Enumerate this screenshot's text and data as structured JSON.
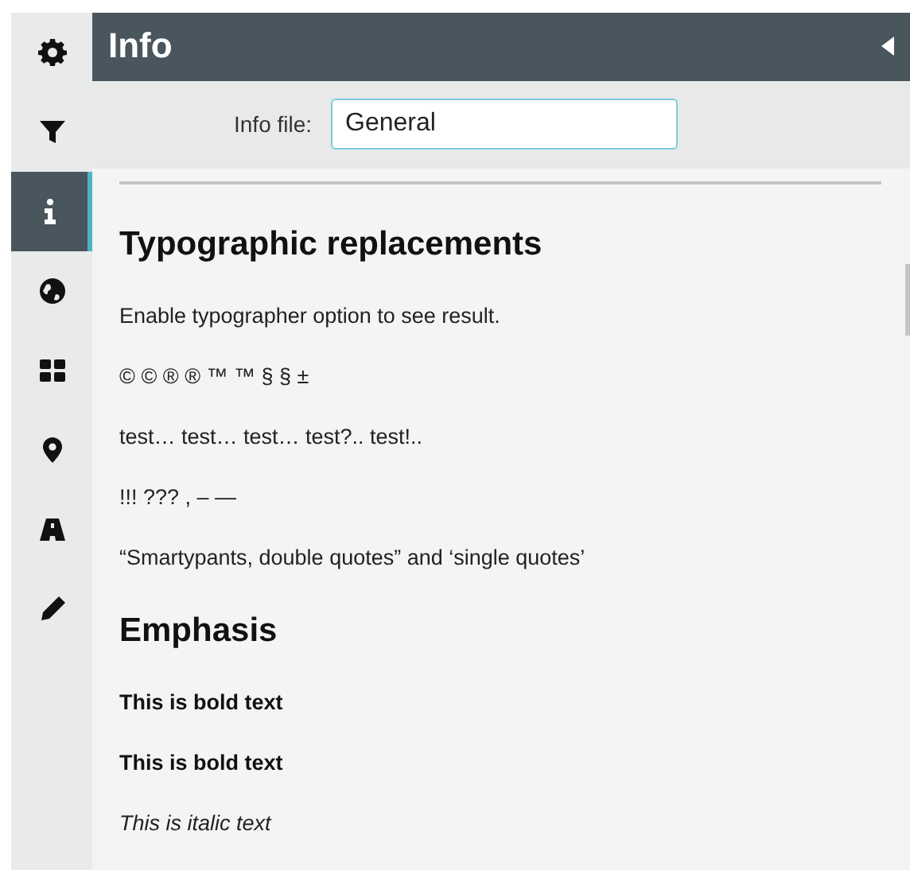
{
  "sidebar": {
    "items": [
      {
        "kind": "gear",
        "selected": false
      },
      {
        "kind": "filter",
        "selected": false
      },
      {
        "kind": "info",
        "selected": true
      },
      {
        "kind": "globe",
        "selected": false
      },
      {
        "kind": "grid",
        "selected": false
      },
      {
        "kind": "marker",
        "selected": false
      },
      {
        "kind": "road",
        "selected": false
      },
      {
        "kind": "pencil",
        "selected": false
      }
    ]
  },
  "panel": {
    "title": "Info",
    "info_file": {
      "label": "Info file:",
      "value": "General"
    }
  },
  "content": [
    {
      "kind": "heading",
      "text": "Typographic replacements"
    },
    {
      "kind": "paragraph",
      "text": "Enable typographer option to see result."
    },
    {
      "kind": "paragraph",
      "text": "© © ® ® ™ ™ § § ±"
    },
    {
      "kind": "paragraph",
      "text": "test… test… test… test?.. test!.."
    },
    {
      "kind": "paragraph",
      "text": "!!! ??? , – —"
    },
    {
      "kind": "paragraph",
      "text": "“Smartypants, double quotes” and ‘single quotes’"
    },
    {
      "kind": "heading",
      "text": "Emphasis"
    },
    {
      "kind": "bold",
      "text": "This is bold text"
    },
    {
      "kind": "bold",
      "text": "This is bold text"
    },
    {
      "kind": "italic",
      "text": "This is italic text"
    }
  ]
}
